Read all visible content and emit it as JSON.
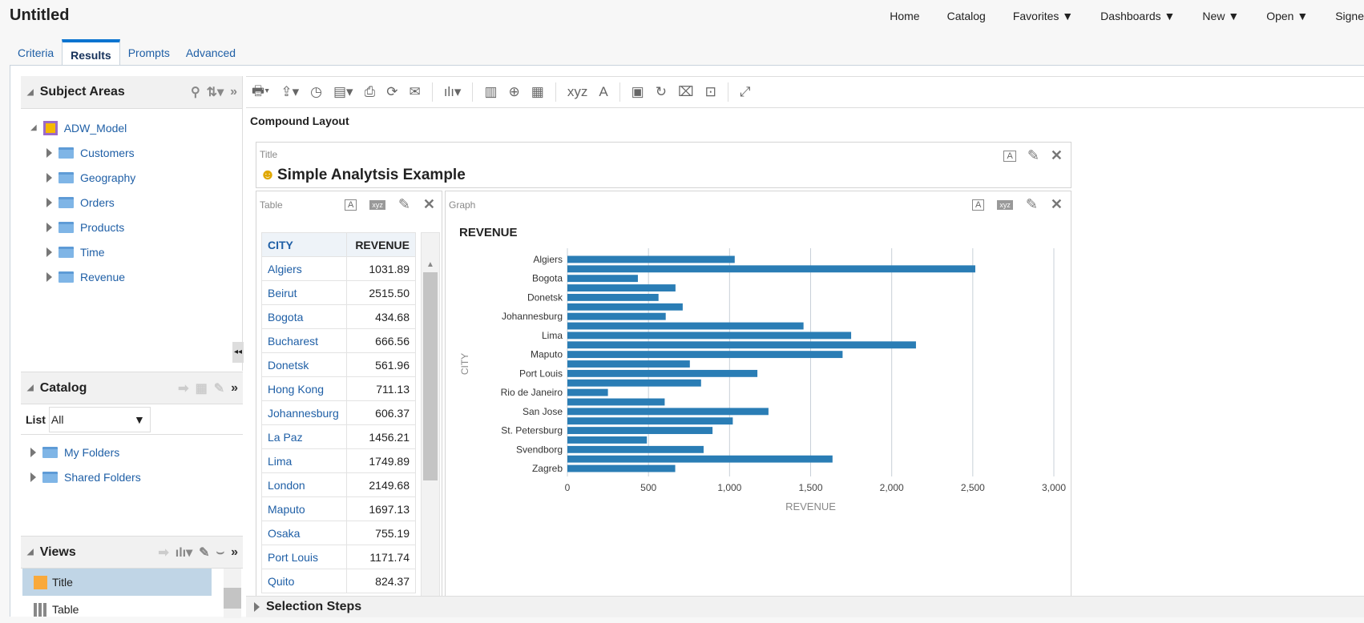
{
  "header": {
    "title": "Untitled",
    "nav": [
      "Home",
      "Catalog",
      "Favorites ▼",
      "Dashboards ▼",
      "New ▼",
      "Open ▼",
      "Signe"
    ]
  },
  "tabs": [
    {
      "label": "Criteria"
    },
    {
      "label": "Results",
      "active": true
    },
    {
      "label": "Prompts"
    },
    {
      "label": "Advanced"
    }
  ],
  "subject_areas": {
    "title": "Subject Areas",
    "root": "ADW_Model",
    "items": [
      "Customers",
      "Geography",
      "Orders",
      "Products",
      "Time",
      "Revenue"
    ]
  },
  "catalog": {
    "title": "Catalog",
    "list_label": "List",
    "list_value": "All",
    "items": [
      "My Folders",
      "Shared Folders"
    ]
  },
  "views": {
    "title": "Views",
    "items": [
      {
        "label": "Title",
        "selected": true
      },
      {
        "label": "Table"
      }
    ]
  },
  "layout": {
    "label": "Compound Layout",
    "selection_steps": "Selection Steps"
  },
  "title_view": {
    "label": "Title",
    "text": "Simple Analytsis Example"
  },
  "table_view": {
    "label": "Table",
    "columns": [
      "CITY",
      "REVENUE"
    ],
    "rows": [
      [
        "Algiers",
        "1031.89"
      ],
      [
        "Beirut",
        "2515.50"
      ],
      [
        "Bogota",
        "434.68"
      ],
      [
        "Bucharest",
        "666.56"
      ],
      [
        "Donetsk",
        "561.96"
      ],
      [
        "Hong Kong",
        "711.13"
      ],
      [
        "Johannesburg",
        "606.37"
      ],
      [
        "La Paz",
        "1456.21"
      ],
      [
        "Lima",
        "1749.89"
      ],
      [
        "London",
        "2149.68"
      ],
      [
        "Maputo",
        "1697.13"
      ],
      [
        "Osaka",
        "755.19"
      ],
      [
        "Port Louis",
        "1171.74"
      ],
      [
        "Quito",
        "824.37"
      ]
    ]
  },
  "graph_view": {
    "label": "Graph"
  },
  "colors": {
    "bar": "#2a7db5",
    "accent": "#0b74d0"
  },
  "chart_data": {
    "type": "bar",
    "orientation": "horizontal",
    "title": "REVENUE",
    "xlabel": "REVENUE",
    "ylabel": "CITY",
    "xlim": [
      0,
      3000
    ],
    "xticks": [
      "0",
      "500",
      "1,000",
      "1,500",
      "2,000",
      "2,500",
      "3,000"
    ],
    "grid": true,
    "categories": [
      "Algiers",
      "",
      "Bogota",
      "",
      "Donetsk",
      "",
      "Johannesburg",
      "",
      "Lima",
      "",
      "Maputo",
      "",
      "Port Louis",
      "",
      "Rio de Janeiro",
      "",
      "San Jose",
      "",
      "St. Petersburg",
      "",
      "Svendborg",
      "",
      "Zagreb"
    ],
    "values": [
      1031.89,
      2515.5,
      434.68,
      666.56,
      561.96,
      711.13,
      606.37,
      1456.21,
      1749.89,
      2149.68,
      1697.13,
      755.19,
      1171.74,
      824.37,
      250,
      600,
      1240,
      1020,
      895,
      490,
      840,
      1635,
      665
    ]
  }
}
